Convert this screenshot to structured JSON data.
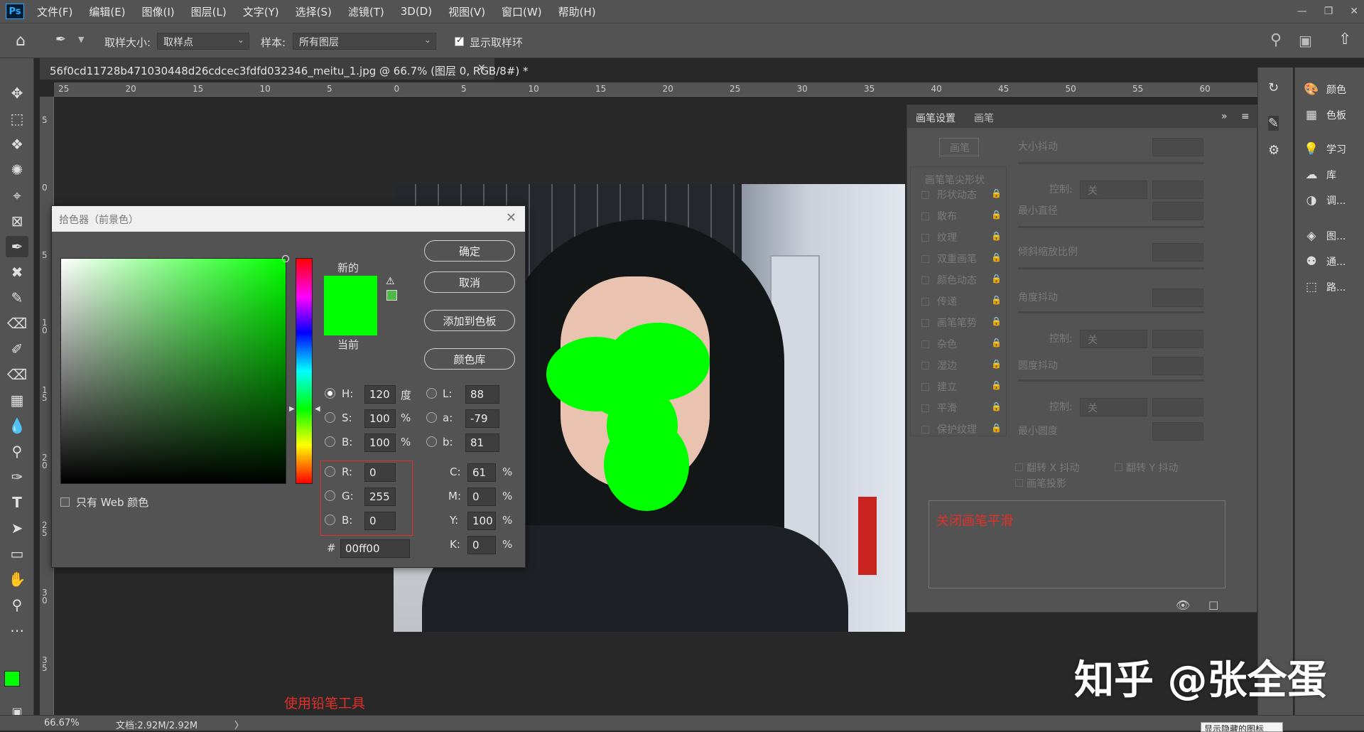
{
  "menubar": {
    "logo": "Ps",
    "items": [
      "文件(F)",
      "编辑(E)",
      "图像(I)",
      "图层(L)",
      "文字(Y)",
      "选择(S)",
      "滤镜(T)",
      "3D(D)",
      "视图(V)",
      "窗口(W)",
      "帮助(H)"
    ]
  },
  "options": {
    "sample_size_label": "取样大小:",
    "sample_size_value": "取样点",
    "sample_label": "样本:",
    "sample_value": "所有图层",
    "show_ring_label": "显示取样环"
  },
  "document": {
    "tab_title": "56f0cd11728b471030448d26cdcec3fdfd032346_meitu_1.jpg @ 66.7% (图层 0, RGB/8#) *"
  },
  "ruler": {
    "h_labels": [
      "25",
      "20",
      "15",
      "10",
      "5",
      "0",
      "5",
      "10",
      "15",
      "20",
      "25",
      "30",
      "35",
      "40",
      "45",
      "50",
      "55",
      "60"
    ],
    "v_labels": [
      "5",
      "0",
      "5",
      "1\n0",
      "1\n5",
      "2\n0",
      "2\n5",
      "3\n0",
      "3\n5"
    ]
  },
  "color_picker": {
    "title": "拾色器（前景色）",
    "new_label": "新的",
    "current_label": "当前",
    "ok": "确定",
    "cancel": "取消",
    "add_swatch": "添加到色板",
    "color_library": "颜色库",
    "web_only": "只有 Web 颜色",
    "h_label": "H:",
    "h_value": "120",
    "h_unit": "度",
    "s_label": "S:",
    "s_value": "100",
    "s_unit": "%",
    "bri_label": "B:",
    "bri_value": "100",
    "bri_unit": "%",
    "r_label": "R:",
    "r_value": "0",
    "g_label": "G:",
    "g_value": "255",
    "b_label": "B:",
    "b_value": "0",
    "l_label": "L:",
    "l_value": "88",
    "a_label": "a:",
    "a_value": "-79",
    "lab_b_label": "b:",
    "lab_b_value": "81",
    "c_label": "C:",
    "c_value": "61",
    "m_label": "M:",
    "m_value": "0",
    "y_label": "Y:",
    "y_value": "100",
    "k_label": "K:",
    "k_value": "0",
    "pct": "%",
    "hash": "#",
    "hex_value": "00ff00",
    "new_color": "#00ff00",
    "current_color": "#00ff00"
  },
  "brush_panel": {
    "tab_settings": "画笔设置",
    "tab_brush": "画笔",
    "brush_button": "画笔",
    "tip_shape": "画笔笔尖形状",
    "options": [
      "形状动态",
      "散布",
      "纹理",
      "双重画笔",
      "颜色动态",
      "传递",
      "画笔笔势",
      "杂色",
      "湿边",
      "建立",
      "平滑",
      "保护纹理"
    ],
    "size_jitter": "大小抖动",
    "control_label": "控制:",
    "control_value": "关",
    "min_diameter": "最小直径",
    "tilt_scale": "倾斜缩放比例",
    "angle_jitter": "角度抖动",
    "roundness_jitter": "圆度抖动",
    "min_roundness": "最小圆度",
    "flip_x": "翻转 X 抖动",
    "flip_y": "翻转 Y 抖动",
    "projection": "画笔投影",
    "note": "关闭画笔平滑"
  },
  "right_panels": {
    "items": [
      {
        "icon": "palette-icon",
        "label": "颜色"
      },
      {
        "icon": "swatches-icon",
        "label": "色板"
      },
      {
        "icon": "lightbulb-icon",
        "label": "学习"
      },
      {
        "icon": "cloud-library-icon",
        "label": "库"
      },
      {
        "icon": "adjustments-icon",
        "label": "调..."
      },
      {
        "icon": "layers-icon",
        "label": "图..."
      },
      {
        "icon": "channels-icon",
        "label": "通..."
      },
      {
        "icon": "paths-icon",
        "label": "路..."
      }
    ]
  },
  "status": {
    "zoom": "66.67%",
    "doc_info": "文档:2.92M/2.92M",
    "arrow": "〉"
  },
  "annotations": {
    "pencil_note": "使用铅笔工具",
    "watermark": "知乎 @张全蛋",
    "tooltip": "显示隐藏的图标"
  },
  "colors": {
    "foreground": "#00ff00",
    "background": "#ffffff",
    "annotation_red": "#e0302a"
  }
}
